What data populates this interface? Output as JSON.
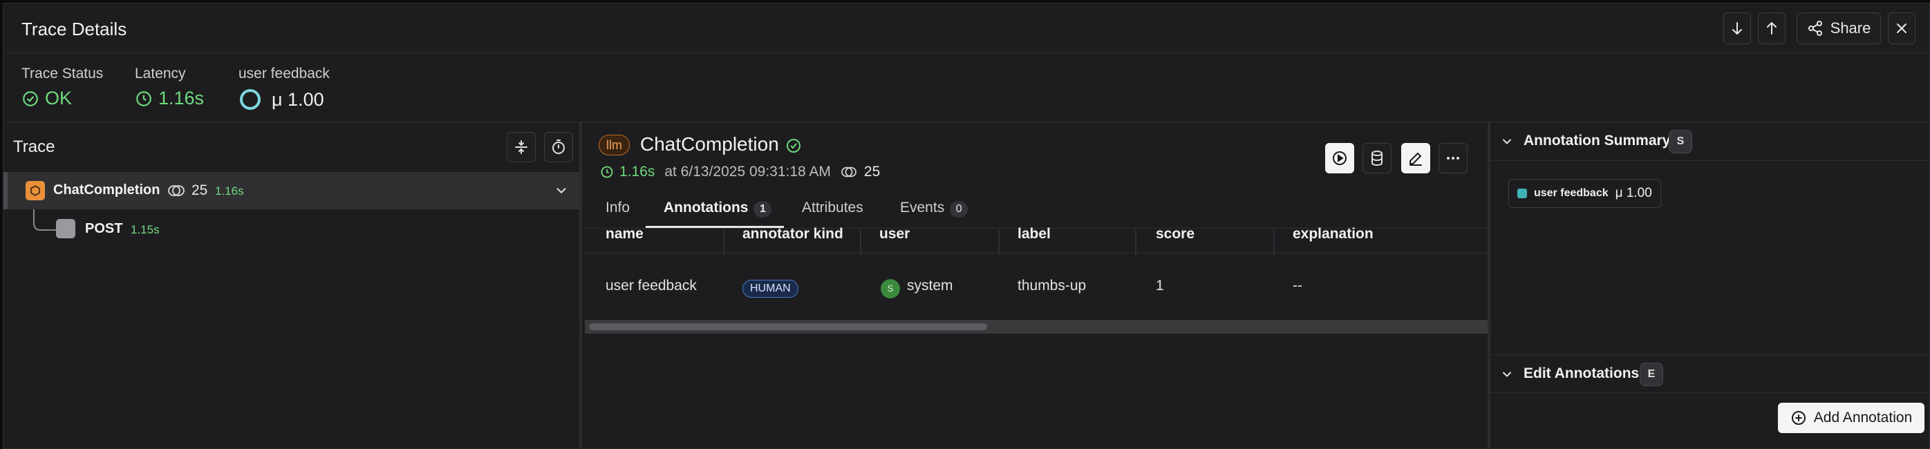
{
  "header": {
    "title": "Trace Details",
    "share_label": "Share"
  },
  "stats": [
    {
      "label": "Trace Status",
      "value": "OK"
    },
    {
      "label": "Latency",
      "value": "1.16s"
    },
    {
      "label": "user feedback",
      "value": "μ 1.00"
    }
  ],
  "trace_panel": {
    "title": "Trace",
    "root": {
      "name": "ChatCompletion",
      "tokens": "25",
      "latency": "1.16s"
    },
    "child": {
      "name": "POST",
      "latency": "1.15s"
    }
  },
  "span": {
    "kind": "llm",
    "name": "ChatCompletion",
    "latency": "1.16s",
    "timestamp": "at 6/13/2025 09:31:18 AM",
    "tokens": "25"
  },
  "tabs": [
    {
      "label": "Info",
      "count": null
    },
    {
      "label": "Annotations",
      "count": "1"
    },
    {
      "label": "Attributes",
      "count": null
    },
    {
      "label": "Events",
      "count": "0"
    }
  ],
  "table": {
    "columns": [
      "name",
      "annotator kind",
      "user",
      "label",
      "score",
      "explanation"
    ],
    "rows": [
      {
        "name": "user feedback",
        "annotator_kind": "HUMAN",
        "user_initial": "S",
        "user": "system",
        "label": "thumbs-up",
        "score": "1",
        "explanation": "--"
      }
    ]
  },
  "annotation_summary": {
    "title": "Annotation Summary",
    "shortcut": "S",
    "chip_name": "user feedback",
    "chip_value": "μ 1.00"
  },
  "edit_annotations": {
    "title": "Edit Annotations",
    "shortcut": "E",
    "add_label": "Add Annotation"
  },
  "colors": {
    "ok_green": "#6fd97d",
    "llm_orange": "#e8913a",
    "chip_teal": "#3fb3b8"
  }
}
